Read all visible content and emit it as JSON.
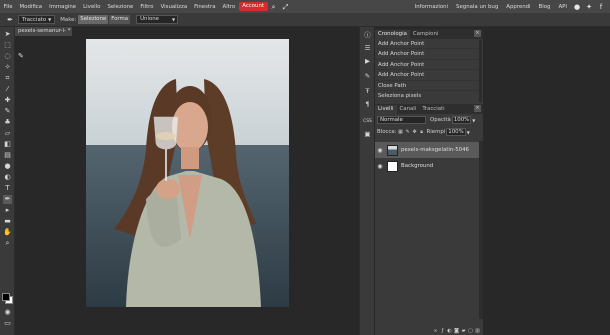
{
  "menu": {
    "items": [
      "File",
      "Modifica",
      "Immagine",
      "Livello",
      "Selezione",
      "Filtro",
      "Visualizza",
      "Finestra",
      "Altro"
    ],
    "active": "Account",
    "right_items": [
      "Informazioni",
      "Segnala un bug",
      "Apprendi",
      "Blog",
      "API"
    ]
  },
  "options": {
    "tool_select": "Tracciato",
    "make_label": "Make:",
    "make_selection": "Selezione",
    "make_shape": "Forma",
    "combine_select": "Unione"
  },
  "document": {
    "tab_label": "pexels-semanur-i- *",
    "close": "×"
  },
  "history": {
    "tabs": [
      "Cronologia",
      "Campioni"
    ],
    "items": [
      "Add Anchor Point",
      "Add Anchor Point",
      "Add Anchor Point",
      "Add Anchor Point",
      "Close Path",
      "Seleziona pixels"
    ]
  },
  "layers": {
    "tabs": [
      "Livelli",
      "Canali",
      "Tracciati"
    ],
    "blend_mode": "Normale",
    "opacity_label": "Opacità",
    "opacity_value": "100%",
    "lock_label": "Blocca:",
    "fill_label": "Riempi",
    "fill_value": "100%",
    "list": [
      {
        "name": "pexels-maksgelatin-5046",
        "selected": true,
        "thumb": "photo"
      },
      {
        "name": "Background",
        "selected": false,
        "thumb": "white"
      }
    ],
    "footer_icons": [
      "link-icon",
      "fx-icon",
      "adjustment-icon",
      "mask-icon",
      "folder-icon",
      "new-layer-icon",
      "trash-icon"
    ]
  },
  "colors": {
    "accent": "#d72c2c",
    "foreground": "#000000",
    "background": "#ffffff"
  }
}
